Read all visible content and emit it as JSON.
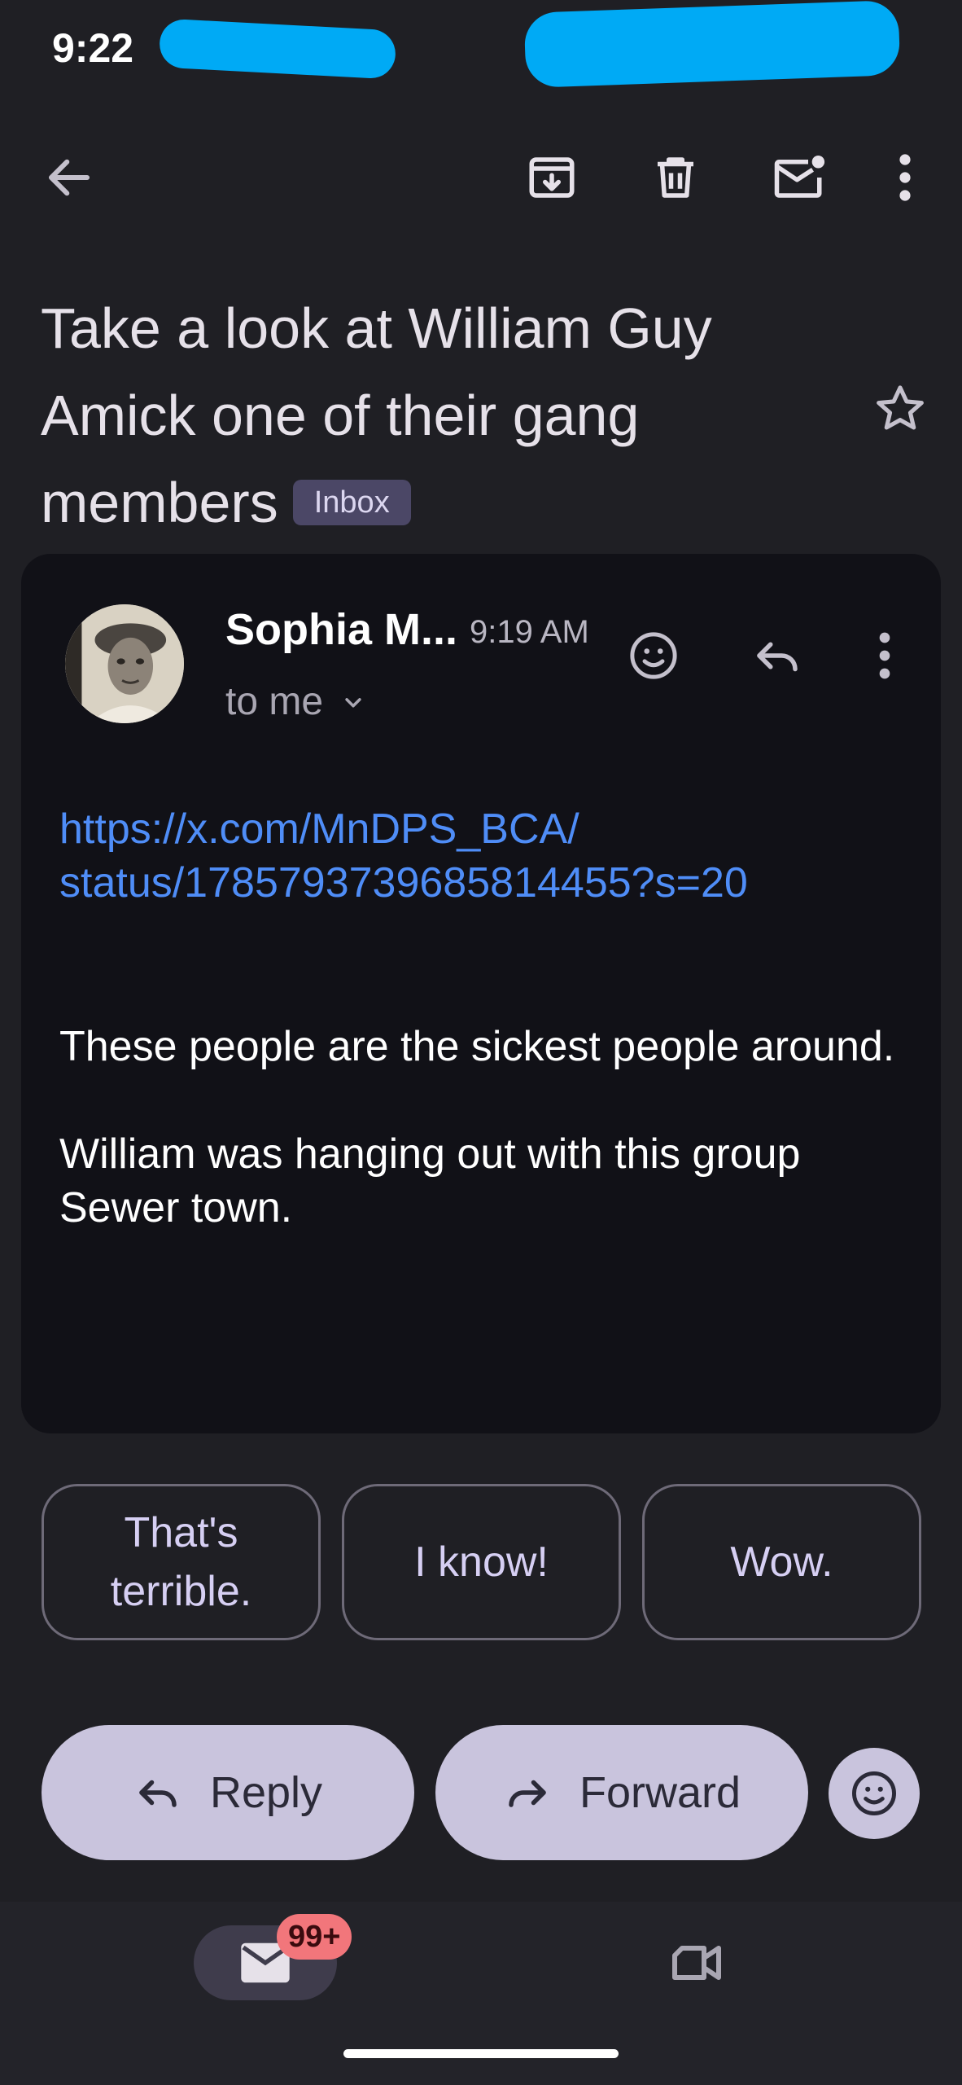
{
  "status_bar": {
    "time": "9:22"
  },
  "toolbar": {
    "back_icon": "arrow-back-icon",
    "archive_icon": "archive-icon",
    "delete_icon": "trash-icon",
    "mark_unread_icon": "mail-unread-icon",
    "more_icon": "more-vert-icon"
  },
  "subject": {
    "text": "Take a look at William Guy Amick one of their gang members",
    "label": "Inbox",
    "star_icon": "star-outline-icon"
  },
  "message": {
    "sender": "Sophia M...",
    "time": "9:19 AM",
    "recipient": "to me",
    "link": "https://x.com/MnDPS_BCA/ status/1785793739685814455?s=20",
    "paragraphs": [
      "These people are the sickest people around.",
      "William was hanging out with this group Sewer town."
    ]
  },
  "smart_replies": [
    "That's terrible.",
    "I know!",
    "Wow."
  ],
  "actions": {
    "reply": "Reply",
    "forward": "Forward"
  },
  "bottom_nav": {
    "mail_badge": "99+"
  },
  "colors": {
    "accent_link": "#4f8df7",
    "pill_bg": "#c9c4dd",
    "badge": "#f2767b"
  }
}
